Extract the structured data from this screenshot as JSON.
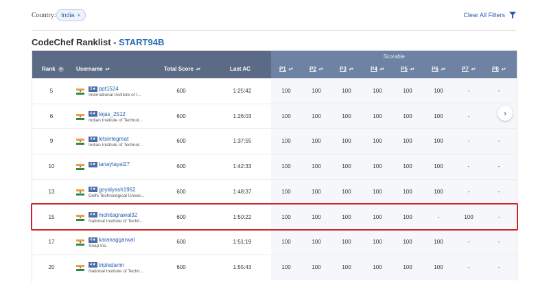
{
  "filters": {
    "country_label": "Country:",
    "country_chip": "India",
    "chip_close": "×",
    "clear_all": "Clear All Filters"
  },
  "title": {
    "prefix": "CodeChef Ranklist - ",
    "contest": "START94B"
  },
  "table": {
    "scorable_label": "Scorable",
    "headers": {
      "rank": "Rank",
      "username": "Username",
      "total": "Total Score",
      "last_ac": "Last AC",
      "problems": [
        "P1",
        "P2",
        "P3",
        "P4",
        "P5",
        "P6",
        "P7",
        "P8"
      ]
    },
    "rows": [
      {
        "rank": "5",
        "username": "ppt1524",
        "stars": "3★",
        "institution": "International Institute of I...",
        "total": "600",
        "last_ac": "1:25:42",
        "scores": [
          "100",
          "100",
          "100",
          "100",
          "100",
          "100",
          "-",
          "-"
        ]
      },
      {
        "rank": "6",
        "username": "tejas_2512",
        "stars": "4★",
        "institution": "Indian Institute of Technol...",
        "total": "600",
        "last_ac": "1:26:03",
        "scores": [
          "100",
          "100",
          "100",
          "100",
          "100",
          "100",
          "-",
          "-"
        ]
      },
      {
        "rank": "9",
        "username": "letsintegreat",
        "stars": "4★",
        "institution": "Indian Institute of Technol...",
        "total": "600",
        "last_ac": "1:37:55",
        "scores": [
          "100",
          "100",
          "100",
          "100",
          "100",
          "100",
          "-",
          "-"
        ]
      },
      {
        "rank": "10",
        "username": "tanaytayal27",
        "stars": "4★",
        "institution": "",
        "total": "600",
        "last_ac": "1:42:33",
        "scores": [
          "100",
          "100",
          "100",
          "100",
          "100",
          "100",
          "-",
          "-"
        ]
      },
      {
        "rank": "13",
        "username": "goyalyash1962",
        "stars": "4★",
        "institution": "Delhi Technological Univer...",
        "total": "600",
        "last_ac": "1:48:37",
        "scores": [
          "100",
          "100",
          "100",
          "100",
          "100",
          "100",
          "-",
          "-"
        ]
      },
      {
        "rank": "15",
        "username": "mohitagrawal32",
        "stars": "4★",
        "institution": "National Institute of Techn...",
        "total": "600",
        "last_ac": "1:50:22",
        "scores": [
          "100",
          "100",
          "100",
          "100",
          "100",
          "-",
          "100",
          "-"
        ]
      },
      {
        "rank": "17",
        "username": "karanaggarwal",
        "stars": "4★",
        "institution": "Snap Inc.",
        "total": "600",
        "last_ac": "1:51:19",
        "scores": [
          "100",
          "100",
          "100",
          "100",
          "100",
          "100",
          "-",
          "-"
        ]
      },
      {
        "rank": "20",
        "username": "tripledamn",
        "stars": "4★",
        "institution": "National Institute of Techn...",
        "total": "600",
        "last_ac": "1:55:43",
        "scores": [
          "100",
          "100",
          "100",
          "100",
          "100",
          "100",
          "-",
          "-"
        ]
      }
    ]
  },
  "colors": {
    "accent": "#2a5db0",
    "header_left": "#5b6b85",
    "header_right": "#6e82a3",
    "highlight": "#d0222a"
  },
  "icons": {
    "filter": "funnel-icon",
    "scroll": "chevron-right-icon",
    "flag": "india-flag-icon",
    "sort": "sort-icon"
  }
}
